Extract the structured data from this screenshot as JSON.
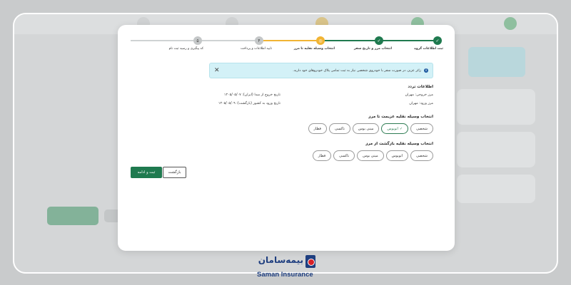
{
  "stepper": {
    "steps": [
      {
        "label": "ثبت اطلاعات گروه",
        "state": "done",
        "symbol": "✓"
      },
      {
        "label": "انتخاب مرز و تاریخ سفر",
        "state": "done",
        "symbol": "✓"
      },
      {
        "label": "انتخاب وسیله نقلیه تا مرز",
        "state": "active",
        "symbol": "◎"
      },
      {
        "label": "تایید اطلاعات و پرداخت",
        "state": "pending",
        "symbol": "۴"
      },
      {
        "label": "کد پیگیری و رسید ثبت نام",
        "state": "pending",
        "symbol": "۵"
      }
    ]
  },
  "alert": {
    "text": "زائر عزیز، در صورت سفر با خودروی شخصی نیاز به ثبت تمامی پلاک خودروهای خود دارید.",
    "info_icon": "i",
    "close_icon": "✕"
  },
  "trip_info": {
    "title": "اطلاعات تردد",
    "exit_border": "مرز خروجی: مهران",
    "entry_border": "مرز ورود: مهران",
    "exit_date": "تاریخ خروج از مبدا (ایران): ۱۴۰۵/۰۵/۰۷",
    "entry_date": "تاریخ ورود به کشور (بازگشت): ۱۴۰۵/۰۵/۰۹"
  },
  "outbound": {
    "title": "انتخاب وسیله نقلیه عزیمت تا مرز",
    "options": [
      {
        "label": "شخصی",
        "selected": false
      },
      {
        "label": "اتوبوس",
        "selected": true
      },
      {
        "label": "مینی بوس",
        "selected": false
      },
      {
        "label": "تاکسی",
        "selected": false
      },
      {
        "label": "قطار",
        "selected": false
      }
    ]
  },
  "return": {
    "title": "انتخاب وسیله نقلیه بازگشت از مرز",
    "options": [
      {
        "label": "شخصی",
        "selected": false
      },
      {
        "label": "اتوبوس",
        "selected": false
      },
      {
        "label": "مینی بوس",
        "selected": false
      },
      {
        "label": "تاکسی",
        "selected": false
      },
      {
        "label": "قطار",
        "selected": false
      }
    ]
  },
  "actions": {
    "submit_label": "ثبت و ادامه",
    "back_label": "بازگشت"
  },
  "logo": {
    "persian": "بیمه‌سامان",
    "english": "Saman Insurance"
  },
  "colors": {
    "primary_green": "#1f7a4f",
    "active_step": "#f1b434",
    "alert_bg": "#d3f1f7",
    "brand_blue": "#1f3f80",
    "brand_red": "#d72128"
  }
}
